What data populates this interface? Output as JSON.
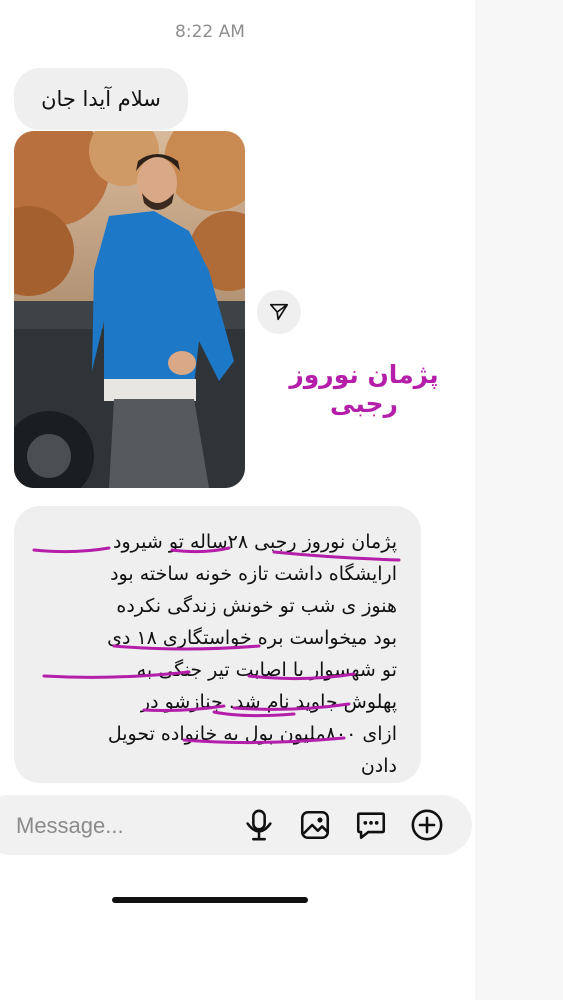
{
  "status": {
    "time": "8:22 AM"
  },
  "messages": {
    "greeting": "سلام آیدا جان",
    "caption": "پژمان نوروز رجبی",
    "body_lines": [
      "پژمان نوروز رجبی ۲۸ساله تو شیرود",
      "ارایشگاه داشت تازه خونه ساخته بود",
      "هنوز ی شب تو خونش زندگی نکرده",
      "بود میخواست بره خواستگاری ۱۸ دی",
      "تو شهسوار با اصابت تیر جنگی به",
      "پهلوش جاوید نام شد. جنازشو در",
      "ازای ۸۰۰ملیون پول به خانواده تحویل",
      "دادن"
    ],
    "annotation_color": "#b41ea8"
  },
  "composer": {
    "placeholder": "Message..."
  },
  "icons": [
    "share-icon",
    "microphone-icon",
    "gallery-icon",
    "sticker-icon",
    "plus-icon"
  ]
}
